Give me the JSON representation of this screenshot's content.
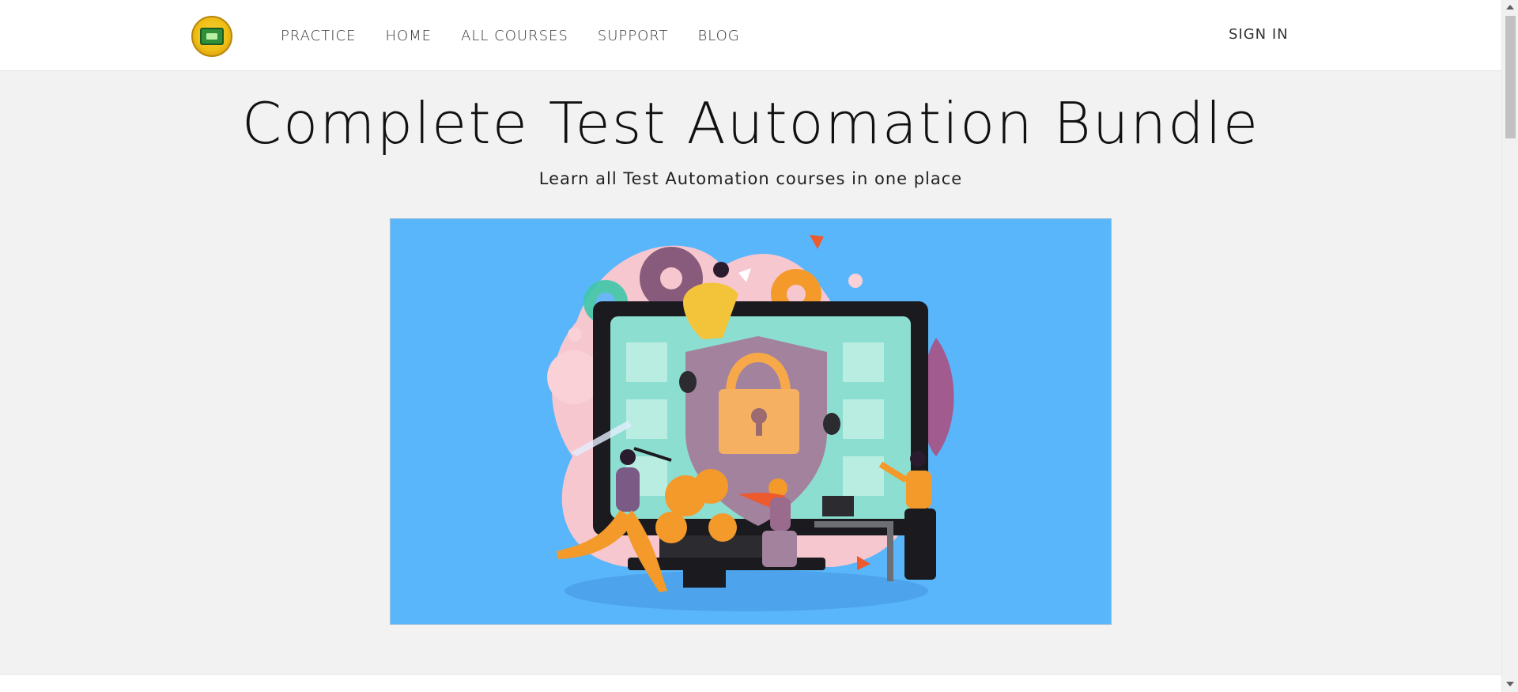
{
  "header": {
    "logo_icon": "school-seal-logo-icon",
    "nav": [
      {
        "label": "PRACTICE"
      },
      {
        "label": "HOME"
      },
      {
        "label": "ALL COURSES"
      },
      {
        "label": "SUPPORT"
      },
      {
        "label": "BLOG"
      }
    ],
    "sign_in": "SIGN IN"
  },
  "hero": {
    "title": "Complete Test Automation Bundle",
    "subtitle": "Learn all Test Automation courses in one place",
    "image_icon": "security-testing-illustration-icon"
  },
  "colors": {
    "hero_bg": "#5ab6fb",
    "page_bg": "#f2f2f2",
    "header_bg": "#ffffff"
  }
}
